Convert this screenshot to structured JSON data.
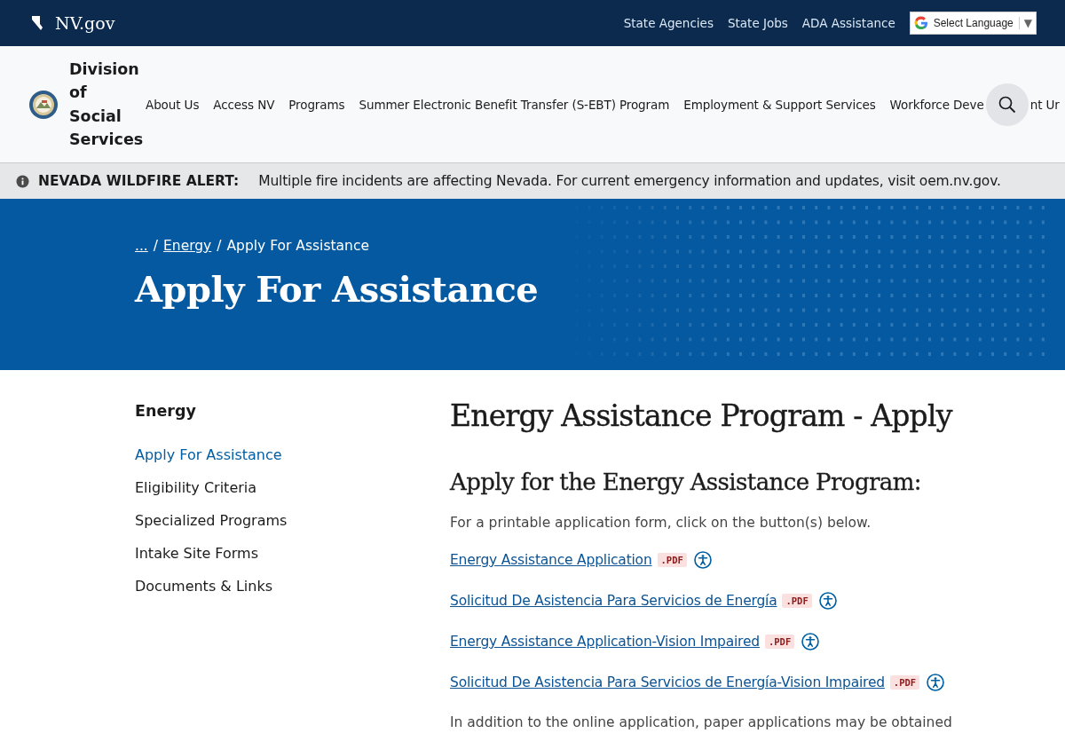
{
  "top_bar": {
    "site": "NV.gov",
    "links": [
      "State Agencies",
      "State Jobs",
      "ADA Assistance"
    ],
    "language": {
      "label": "Select Language",
      "caret": "▼"
    }
  },
  "header": {
    "agency": [
      "Division",
      "of",
      "Social",
      "Services"
    ],
    "nav": [
      "About Us",
      "Access NV",
      "Programs",
      "Summer Electronic Benefit Transfer (S-EBT) Program",
      "Employment & Support Services",
      "Workforce Deve",
      "nt Ur"
    ]
  },
  "alert": {
    "title": "NEVADA WILDFIRE ALERT:",
    "message": "Multiple fire incidents are affecting Nevada. For current emergency information and updates, visit oem.nv.gov."
  },
  "hero": {
    "breadcrumbs": [
      {
        "label": "...",
        "link": true
      },
      {
        "label": "Energy",
        "link": true
      },
      {
        "label": "Apply For Assistance",
        "link": false
      }
    ],
    "separator": "/",
    "title": "Apply For Assistance"
  },
  "sidebar": {
    "title": "Energy",
    "items": [
      {
        "label": "Apply For Assistance",
        "selected": true
      },
      {
        "label": "Eligibility Criteria",
        "selected": false
      },
      {
        "label": "Specialized Programs",
        "selected": false
      },
      {
        "label": "Intake Site Forms",
        "selected": false
      },
      {
        "label": "Documents & Links",
        "selected": false
      }
    ]
  },
  "main": {
    "title": "Energy Assistance Program - Apply",
    "subtitle": "Apply for the Energy Assistance Program:",
    "intro": "For a printable application form, click on the button(s) below.",
    "documents": [
      {
        "label": "Energy Assistance Application",
        "badge": ".PDF"
      },
      {
        "label": "Solicitud De Asistencia Para Servicios de Energía",
        "badge": ".PDF"
      },
      {
        "label": "Energy Assistance Application-Vision Impaired",
        "badge": ".PDF"
      },
      {
        "label": "Solicitud De Asistencia Para Servicios de Energía-Vision Impaired",
        "badge": ".PDF"
      }
    ],
    "note": "In addition to the online application, paper applications may be obtained"
  }
}
